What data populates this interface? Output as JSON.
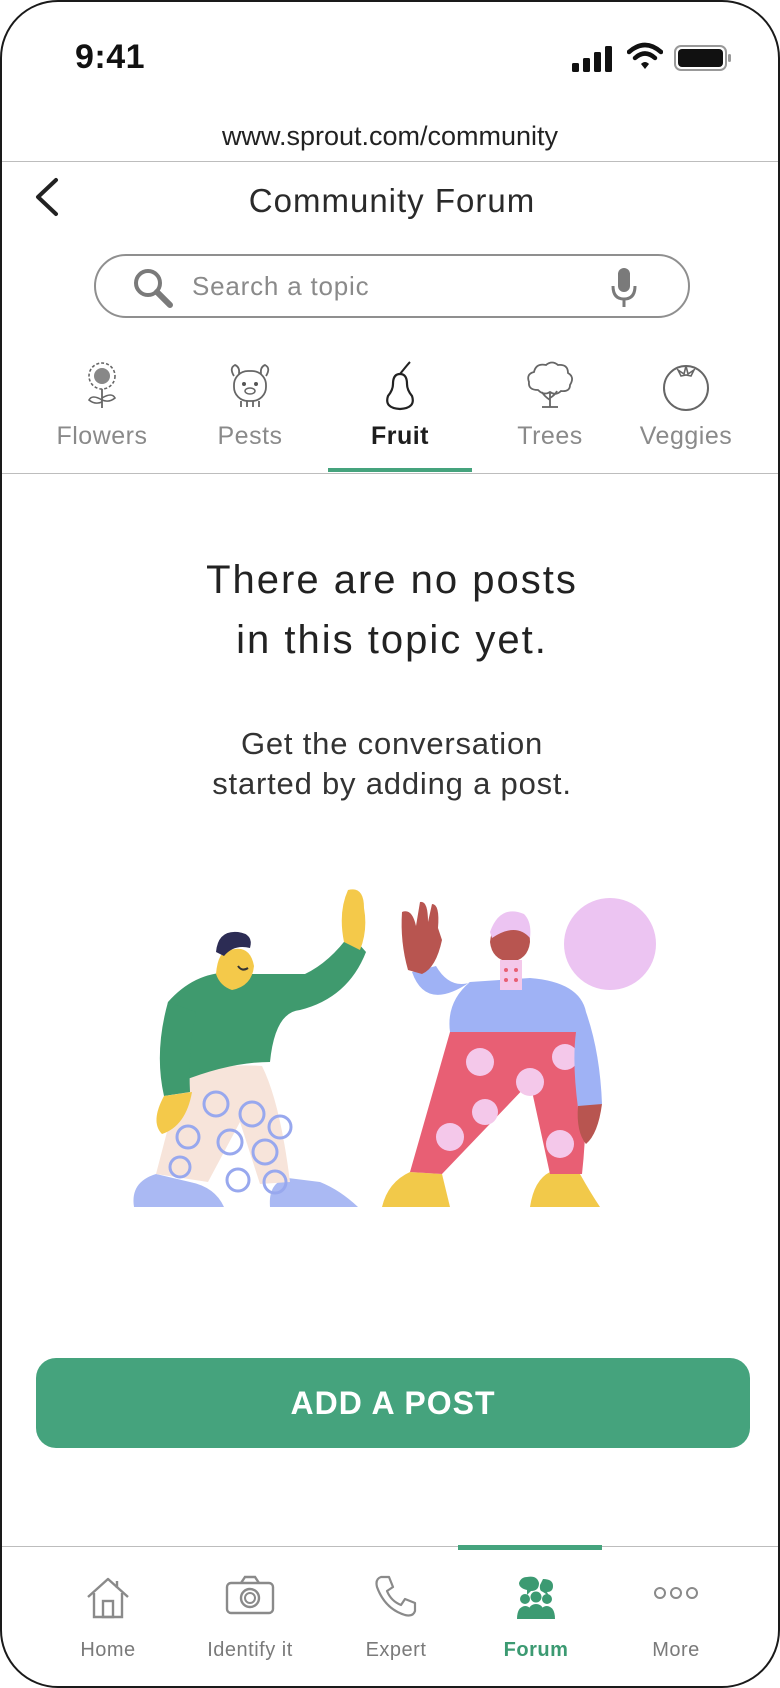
{
  "status_bar": {
    "time": "9:41"
  },
  "browser": {
    "url": "www.sprout.com/community"
  },
  "header": {
    "title": "Community Forum"
  },
  "search": {
    "placeholder": "Search a topic"
  },
  "topics": {
    "active": "Fruit",
    "items": [
      {
        "label": "Flowers",
        "icon": "sunflower-icon"
      },
      {
        "label": "Pests",
        "icon": "bug-icon"
      },
      {
        "label": "Fruit",
        "icon": "pear-icon"
      },
      {
        "label": "Trees",
        "icon": "tree-icon"
      },
      {
        "label": "Veggies",
        "icon": "tomato-icon"
      }
    ]
  },
  "empty_state": {
    "title_line1": "There are no posts",
    "title_line2": "in this topic yet.",
    "subtitle_line1": "Get the conversation",
    "subtitle_line2": "started by adding a post."
  },
  "cta": {
    "label": "ADD A POST"
  },
  "bottom_nav": {
    "active": "Forum",
    "items": [
      {
        "label": "Home",
        "icon": "home-icon"
      },
      {
        "label": "Identify it",
        "icon": "camera-icon"
      },
      {
        "label": "Expert",
        "icon": "phone-icon"
      },
      {
        "label": "Forum",
        "icon": "people-icon"
      },
      {
        "label": "More",
        "icon": "more-icon"
      }
    ]
  },
  "colors": {
    "accent": "#45a37d",
    "text": "#222222",
    "muted": "#8a8a8a",
    "divider": "#bdbdbd"
  }
}
